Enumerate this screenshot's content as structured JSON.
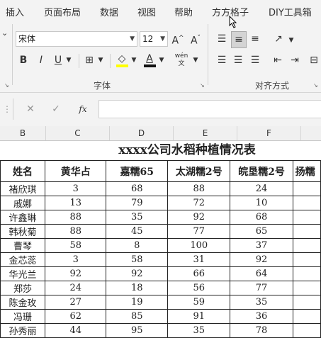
{
  "ribbon_tabs": [
    "插入",
    "页面布局",
    "数据",
    "视图",
    "帮助",
    "方方格子",
    "DIY工具箱"
  ],
  "font": {
    "name": "宋体",
    "size": "12",
    "bold": "B",
    "italic": "I",
    "underline": "U",
    "grow": "A^",
    "shrink": "A˅",
    "phonetic": "wén 文"
  },
  "groups": {
    "font_label": "字体",
    "align_label": "对齐方式"
  },
  "formula": {
    "fx": "fx",
    "value": ""
  },
  "columns": [
    "B",
    "C",
    "D",
    "E",
    "F"
  ],
  "sheet_title": "xxxx公司水稻种植情况表",
  "headers": [
    "姓名",
    "黄华占",
    "嘉糯65",
    "太湖糯2号",
    "皖垦糯2号",
    "扬糯"
  ],
  "rows": [
    [
      "褚欣琪",
      "3",
      "68",
      "88",
      "24"
    ],
    [
      "戚娜",
      "13",
      "79",
      "72",
      "10"
    ],
    [
      "许鑫琳",
      "88",
      "35",
      "92",
      "68"
    ],
    [
      "韩秋菊",
      "88",
      "45",
      "77",
      "65"
    ],
    [
      "曹琴",
      "58",
      "8",
      "100",
      "37"
    ],
    [
      "金芯蕊",
      "3",
      "58",
      "31",
      "92"
    ],
    [
      "华光兰",
      "92",
      "92",
      "66",
      "64"
    ],
    [
      "郑莎",
      "24",
      "18",
      "56",
      "77"
    ],
    [
      "陈金玫",
      "27",
      "19",
      "59",
      "35"
    ],
    [
      "冯珊",
      "62",
      "85",
      "91",
      "36"
    ],
    [
      "孙秀丽",
      "44",
      "95",
      "35",
      "78"
    ]
  ]
}
